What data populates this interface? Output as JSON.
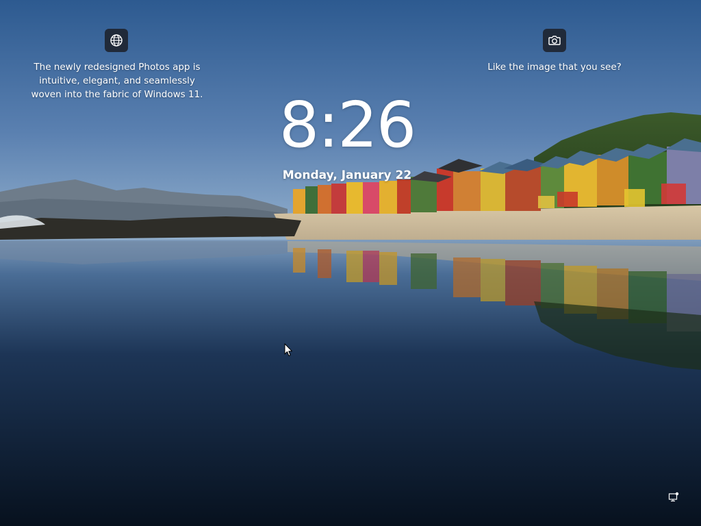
{
  "lockscreen": {
    "clock": {
      "time": "8:26"
    },
    "date": {
      "label": "Monday, January 22"
    },
    "left_tip": {
      "icon": "globe-icon",
      "lines": [
        "The newly redesigned Photos app is",
        "intuitive, elegant, and seamlessly",
        "woven into the fabric of Windows 11."
      ]
    },
    "right_tip": {
      "icon": "camera-icon",
      "text": "Like the image that you see?"
    },
    "status_icon": "network-icon",
    "pointer": "cursor-arrow-icon"
  },
  "colors": {
    "sky_top": "#2f5b8f",
    "sky_bottom": "#8aa8c8",
    "water_deep": "#0d1a2c",
    "sand": "#c9b89c",
    "text": "#ffffff"
  }
}
